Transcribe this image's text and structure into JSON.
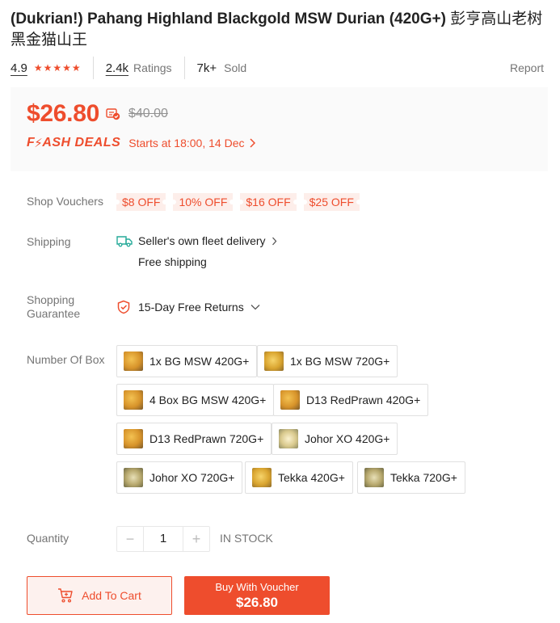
{
  "product": {
    "title_en": "(Dukrian!) Pahang Highland Blackgold MSW Durian (420G+)",
    "title_cn": "彭亨高山老树黑金猫山王"
  },
  "stats": {
    "rating": "4.9",
    "rating_stars": 5,
    "ratings_count": "2.4k",
    "ratings_label": "Ratings",
    "sold_count": "7k+",
    "sold_label": "Sold",
    "report_label": "Report"
  },
  "price": {
    "current": "$26.80",
    "original": "$40.00",
    "flash_label": "FLASH DEALS",
    "flash_prefix": "F",
    "flash_suffix": "ASH DEALS",
    "flash_time": "Starts at 18:00, 14 Dec"
  },
  "vouchers": {
    "label": "Shop Vouchers",
    "items": [
      "$8 OFF",
      "10% OFF",
      "$16 OFF",
      "$25 OFF"
    ]
  },
  "shipping": {
    "label": "Shipping",
    "method": "Seller's own fleet delivery",
    "fee": "Free shipping"
  },
  "guarantee": {
    "label_line1": "Shopping",
    "label_line2": "Guarantee",
    "value": "15-Day Free Returns"
  },
  "options": {
    "label": "Number Of Box",
    "items": [
      "1x BG MSW 420G+",
      "1x BG MSW 720G+",
      "4 Box BG MSW 420G+",
      "D13 RedPrawn 420G+",
      "D13 RedPrawn 720G+",
      "Johor XO 420G+",
      "Johor XO 720G+",
      "Tekka 420G+",
      "Tekka 720G+"
    ]
  },
  "quantity": {
    "label": "Quantity",
    "value": "1",
    "minus": "−",
    "plus": "+",
    "stock": "IN STOCK"
  },
  "actions": {
    "add_to_cart": "Add To Cart",
    "buy_label": "Buy With Voucher",
    "buy_price": "$26.80"
  },
  "colors": {
    "accent": "#ee4d2d",
    "voucher_bg": "#fdeeea",
    "shipping_icon": "#26aa99"
  }
}
